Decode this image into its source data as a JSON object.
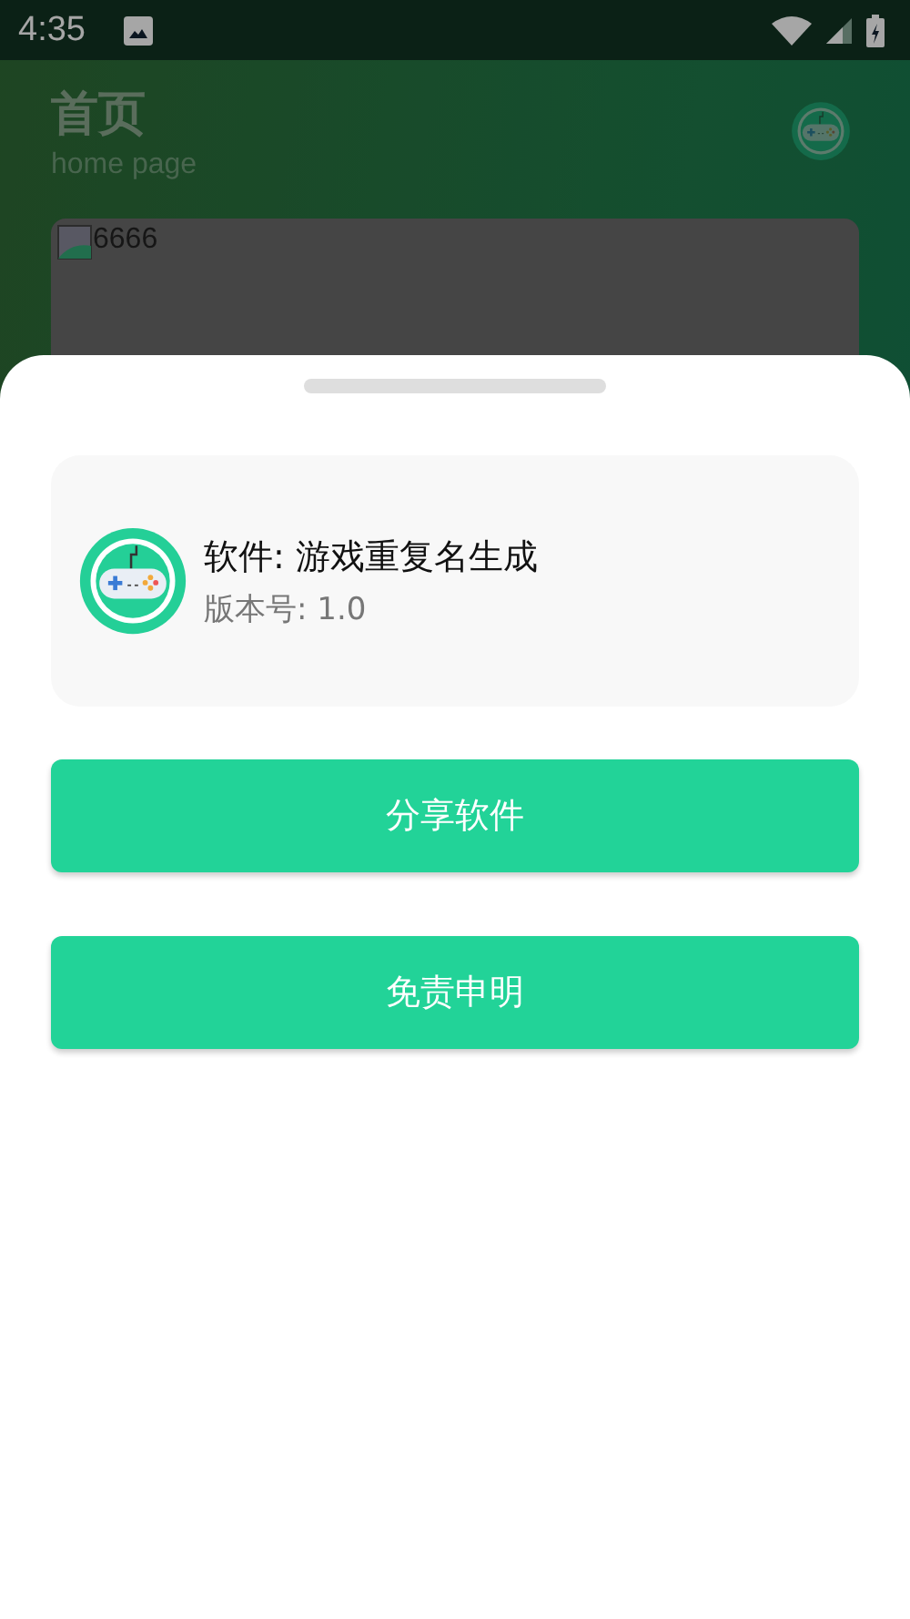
{
  "status_bar": {
    "time": "4:35"
  },
  "header": {
    "title": "首页",
    "subtitle": "home page"
  },
  "banner": {
    "alt_text": "6666"
  },
  "sheet": {
    "app_name": "软件: 游戏重复名生成",
    "version": "版本号: 1.0",
    "buttons": [
      "分享软件",
      "免责申明"
    ]
  }
}
